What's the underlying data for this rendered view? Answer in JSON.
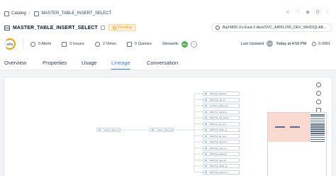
{
  "breadcrumb": {
    "root": "Catalog",
    "current": "MASTER_TABLE_INSERT_SELECT"
  },
  "header": {
    "title": "MASTER_TABLE_INSERT_SELECT",
    "status": "Pending",
    "path": "Bq24865.Us-East-2.Aws/SVC_AIRFLOW_DEV_WH/DQLAB..."
  },
  "stats": {
    "score": "47%",
    "score_fraction": 0.47,
    "alerts": "0 Alerts",
    "issues": "0 Issues",
    "views": "2 Views",
    "queries": "0 Queries",
    "stewards_label": "Stewards",
    "steward_initials": "KU",
    "last_updated_label": "Last Updated",
    "last_updated_value": "Today at 4:56 PM",
    "updater_initials": "SVC",
    "cost": "0.0001"
  },
  "tabs": [
    {
      "label": "Overview"
    },
    {
      "label": "Properties"
    },
    {
      "label": "Usage"
    },
    {
      "label": "Lineage"
    },
    {
      "label": "Conversation"
    }
  ],
  "lineage": {
    "source_node": "master_table_ins...",
    "middle_node": "master_table_inse...",
    "target_nodes": [
      "RESTful_datawar...",
      "RESTful_rpa_te...",
      "sandbx1_table_tes...",
      "RESTful_warehou...",
      "RESTful_rpa_wareh...",
      "RESTful_de_test...",
      "RESTful_dqlab_te...",
      "RESTful_dq_test...",
      "RESTful_warehou...",
      "RESTful_ware_te...",
      "RESTful_datawar...",
      "RESTful_rpa_sel...",
      "RESTful_dqlab_w...",
      "RESTful_warehou..."
    ]
  }
}
